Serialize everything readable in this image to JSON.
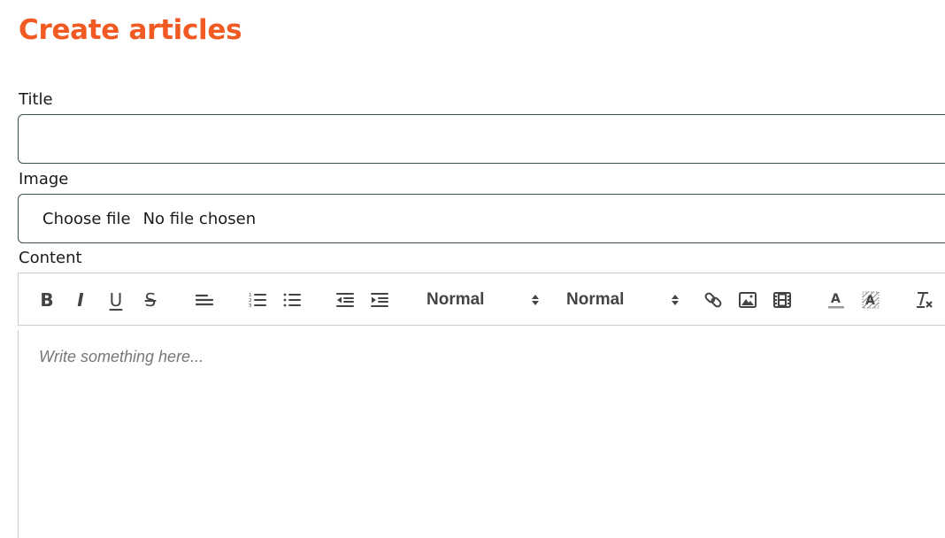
{
  "page": {
    "title": "Create articles",
    "accent_color": "#f15a22"
  },
  "form": {
    "title_label": "Title",
    "title_value": "",
    "image_label": "Image",
    "image_button": "Choose file",
    "image_status": "No file chosen",
    "content_label": "Content"
  },
  "toolbar": {
    "bold": "B",
    "italic": "I",
    "underline": "U",
    "strike": "S",
    "header_picker": "Normal",
    "size_picker": "Normal",
    "icons": [
      "bold-icon",
      "italic-icon",
      "underline-icon",
      "strike-icon",
      "align-icon",
      "ordered-list-icon",
      "bullet-list-icon",
      "outdent-icon",
      "indent-icon",
      "link-icon",
      "image-icon",
      "video-icon",
      "text-color-icon",
      "background-color-icon",
      "clear-format-icon"
    ]
  },
  "editor": {
    "placeholder": "Write something here..."
  }
}
